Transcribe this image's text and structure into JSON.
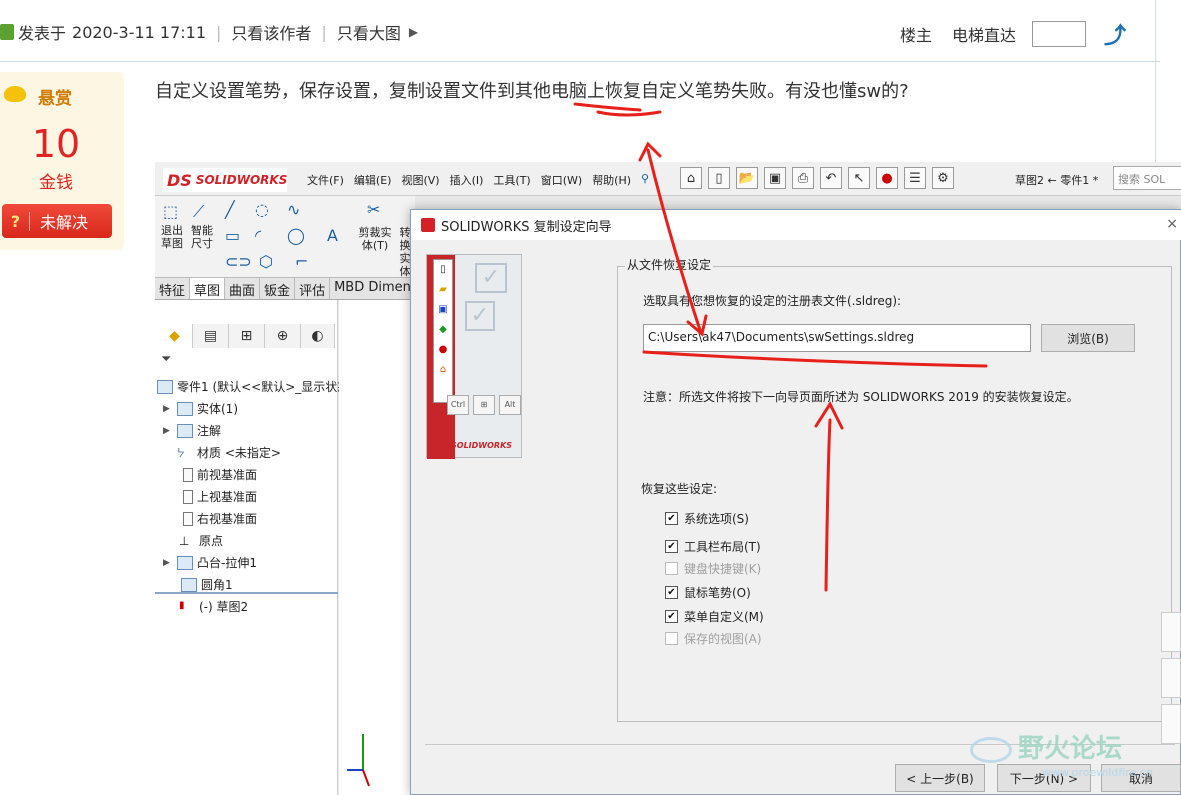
{
  "header": {
    "posted_label": "发表于",
    "posted_time": "2020-3-11 17:11",
    "author_only": "只看该作者",
    "images_only": "只看大图",
    "floor": "楼主",
    "jump_label": "电梯直达"
  },
  "reward": {
    "title": "悬赏",
    "amount": "10",
    "unit": "金钱",
    "status_icon": "?",
    "status": "未解决"
  },
  "question": "自定义设置笔势，保存设置，复制设置文件到其他电脑上恢复自定义笔势失败。有没也懂sw的?",
  "solidworks": {
    "brand_ds": "DS",
    "brand": "SOLIDWORKS",
    "menu": [
      "文件(F)",
      "编辑(E)",
      "视图(V)",
      "插入(I)",
      "工具(T)",
      "窗口(W)",
      "帮助(H)"
    ],
    "breadcrumb": "草图2 ← 零件1 *",
    "search_placeholder": "搜索 SOL",
    "ribbon": {
      "exit_sketch": "退出草图",
      "smart_dim": "智能尺寸",
      "trim": "剪裁实体(T)",
      "convert": "转换实体"
    },
    "tabs": [
      "特征",
      "草图",
      "曲面",
      "钣金",
      "评估",
      "MBD Dimen"
    ],
    "active_tab": "草图",
    "tree": [
      {
        "label": "零件1 (默认<<默认>_显示状态",
        "icon": "part-icon"
      },
      {
        "label": "实体(1)",
        "icon": "solid-bodies-icon"
      },
      {
        "label": "注解",
        "icon": "annotations-icon"
      },
      {
        "label": "材质 <未指定>",
        "icon": "material-icon"
      },
      {
        "label": "前视基准面",
        "icon": "plane-icon"
      },
      {
        "label": "上视基准面",
        "icon": "plane-icon"
      },
      {
        "label": "右视基准面",
        "icon": "plane-icon"
      },
      {
        "label": "原点",
        "icon": "origin-icon"
      },
      {
        "label": "凸台-拉伸1",
        "icon": "extrude-icon"
      },
      {
        "label": "圆角1",
        "icon": "fillet-icon"
      },
      {
        "label": "(-) 草图2",
        "icon": "sketch-icon"
      }
    ]
  },
  "dialog": {
    "title": "SOLIDWORKS 复制设定向导",
    "group_title": "从文件恢复设定",
    "select_label": "选取具有您想恢复的设定的注册表文件(.sldreg):",
    "file_path": "C:\\Users\\ak47\\Documents\\swSettings.sldreg",
    "browse": "浏览(B)",
    "note": "注意：所选文件将按下一向导页面所述为 SOLIDWORKS 2019 的安装恢复设定。",
    "restore_label": "恢复这些设定:",
    "options": [
      {
        "label": "系统选项(S)",
        "checked": true,
        "enabled": true
      },
      {
        "label": "工具栏布局(T)",
        "checked": true,
        "enabled": true
      },
      {
        "label": "键盘快捷键(K)",
        "checked": false,
        "enabled": false
      },
      {
        "label": "鼠标笔势(O)",
        "checked": true,
        "enabled": true
      },
      {
        "label": "菜单自定义(M)",
        "checked": true,
        "enabled": true
      },
      {
        "label": "保存的视图(A)",
        "checked": false,
        "enabled": false
      }
    ],
    "back": "< 上一步(B)",
    "next": "下一步(N) >",
    "cancel": "取消",
    "side_brand": "SOLIDWORKS",
    "side_keys": [
      "Ctrl",
      "⊞",
      "Alt"
    ]
  },
  "watermark": {
    "text": "野火论坛",
    "url": "www.proewildfire.cn"
  },
  "annotation_color": "#e8201a"
}
